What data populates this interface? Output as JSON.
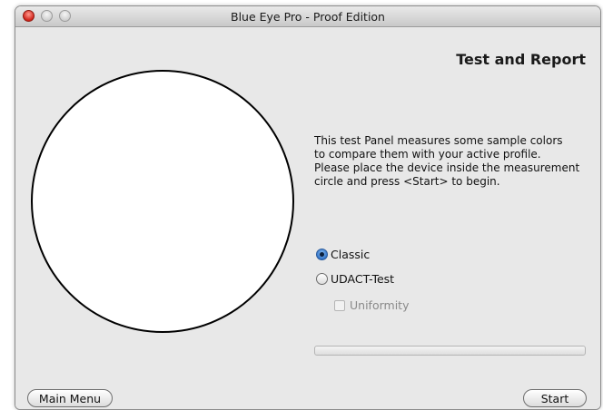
{
  "window": {
    "title": "Blue Eye Pro - Proof Edition"
  },
  "panel": {
    "heading": "Test and Report",
    "description": "This test Panel measures some sample colors\nto compare them with your active profile.\nPlease place the device inside the measurement\ncircle and press <Start> to begin."
  },
  "options": {
    "classic_label": "Classic",
    "classic_selected": true,
    "udact_label": "UDACT-Test",
    "udact_selected": false,
    "uniformity_label": "Uniformity",
    "uniformity_checked": false,
    "uniformity_enabled": false
  },
  "progress": {
    "value": 0
  },
  "buttons": {
    "main_menu": "Main Menu",
    "start": "Start"
  },
  "colors": {
    "close": "#d1231a",
    "radio_selected": "#2c6fc6"
  }
}
